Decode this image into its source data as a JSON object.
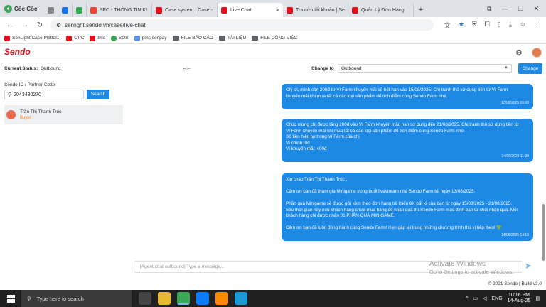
{
  "browser": {
    "brand": "Cốc Cốc",
    "tabs": [
      {
        "label": "",
        "color": "#888888"
      },
      {
        "label": "",
        "color": "#1a73e8"
      },
      {
        "label": "",
        "color": "#34a853"
      },
      {
        "label": "SFC - THÔNG TIN KI",
        "color": "#ea4335"
      },
      {
        "label": "Case system | Case -",
        "color": "#e5101d"
      },
      {
        "label": "Live Chat",
        "color": "#e5101d"
      },
      {
        "label": "Tra cứu tài khoản | Se",
        "color": "#e5101d"
      },
      {
        "label": "Quản Lý Đơn Hàng",
        "color": "#e5101d"
      }
    ],
    "active_tab_close": "×",
    "new_tab": "+",
    "url": "senlight.sendo.vn/case/live-chat",
    "bookmarks": [
      "SenLight Case Platfor...",
      "OPC",
      "tms",
      "SOS",
      "pms senpay",
      "FILE BÁO CÁO",
      "TÀI LIỆU",
      "FILE CÔNG VIỆC"
    ]
  },
  "app": {
    "logo": "Sendo",
    "status_label": "Current Status:",
    "status_value": "Outbound",
    "status_time": "--:--",
    "change_to_label": "Change to",
    "change_to_value": "Outbound",
    "change_button": "Change"
  },
  "sidebar": {
    "search_label": "Sendo ID / Partner Code:",
    "search_value": "2043480270",
    "search_button": "Search",
    "conversation": {
      "initial": "T",
      "name": "Trần Thị Thanh Trúc",
      "role": "Buyer"
    }
  },
  "messages": [
    {
      "lines": [
        "Chị ơi, mình còn 200đ từ Ví Farm khuyến mãi sẽ hết hạn vào 15/08/2025. Chị tranh thủ sử dụng tiền từ Ví Farm",
        "khuyến mãi khi mua tất cả các loại sản phẩm để tích điểm cùng Sendo Farm nhé."
      ],
      "time": "13/08/2025 10:00"
    },
    {
      "lines": [
        "Chúc mừng chị được tặng 200đ vào Ví Farm khuyến mãi, hạn sử dụng đến 21/08/2025. Chị tranh thủ sử dụng tiền từ",
        "Ví Farm khuyến mãi khi mua tất cả các loại sản phẩm để tích điểm cùng Sendo Farm nhé.",
        "Số tiền hiện tại trong Ví Farm của chị",
        "Ví chính: 0đ",
        "Ví khuyến mãi: 400đ"
      ],
      "time": "14/08/2025 11:39"
    },
    {
      "lines": [
        "Xin chào Trần Thị Thanh Trúc ,",
        "",
        "Cảm ơn bạn đã tham gia Minigame trong buổi livestream nhà Sendo Farm tối ngày 13/08/2025.",
        "",
        "Phần quà Minigame sẽ được gửi kèm theo đơn hàng tối thiểu 6K bất kì của bạn từ ngày 15/08/2025 - 21/08/2025.",
        "Sau thời gian này nếu khách hàng chưa mua hàng để nhận quà thì Sendo Farm mặc định bạn từ chối nhận quà. Mỗi",
        "khách hàng chỉ được nhận 01 PHẦN QUÀ MINIGAME.",
        "",
        "Cảm ơn bạn đã luôn đồng hành cùng Sendo Farm! Hẹn gặp lại trong những chương trình thú vị tiếp theo! 💚"
      ],
      "time": "14/08/2025 14:10"
    }
  ],
  "composer": {
    "placeholder": "[Agent chat outbound] Type a message..."
  },
  "watermark": {
    "title": "Activate Windows",
    "subtitle": "Go to Settings to activate Windows."
  },
  "footer": "© 2021 Sendo | Build v3.0",
  "taskbar": {
    "search_placeholder": "Type here to search",
    "time": "10:16 PM",
    "date": "14-Aug-25",
    "lang": "ENG"
  }
}
